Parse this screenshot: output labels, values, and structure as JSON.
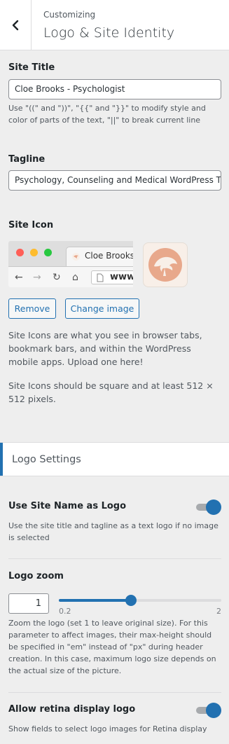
{
  "header": {
    "breadcrumb": "Customizing",
    "title": "Logo & Site Identity"
  },
  "site_title": {
    "label": "Site Title",
    "value": "Cloe Brooks - Psychologist",
    "help": "Use \"((\" and \"))\", \"{{\" and \"}}\" to modify style and color of parts of the text, \"||\" to break current line"
  },
  "tagline": {
    "label": "Tagline",
    "value": "Psychology, Counseling and Medical WordPress Theme"
  },
  "site_icon": {
    "label": "Site Icon",
    "browser_tab_text": "Cloe Brooks",
    "browser_url_text": "www.",
    "remove_label": "Remove",
    "change_label": "Change image",
    "info_1": "Site Icons are what you see in browser tabs, bookmark bars, and within the WordPress mobile apps. Upload one here!",
    "info_2": "Site Icons should be square and at least 512 × 512 pixels.",
    "icon_bg": "#f8efe8",
    "icon_color": "#e8a88b"
  },
  "logo_settings": {
    "section_title": "Logo Settings",
    "use_site_name": {
      "label": "Use Site Name as Logo",
      "desc": "Use the site title and tagline as a text logo if no image is selected",
      "enabled": true
    },
    "logo_zoom": {
      "label": "Logo zoom",
      "value": "1",
      "min": "0.2",
      "max": "2",
      "slider_value": 1,
      "desc": "Zoom the logo (set 1 to leave original size). For this parameter to affect images, their max-height should be specified in \"em\" instead of \"px\" during header creation. In this case, maximum logo size depends on the actual size of the picture."
    },
    "retina": {
      "label": "Allow retina display logo",
      "desc": "Show fields to select logo images for Retina display",
      "enabled": true
    }
  },
  "colors": {
    "accent": "#2271b1",
    "panel_bg": "#eeeeee"
  }
}
